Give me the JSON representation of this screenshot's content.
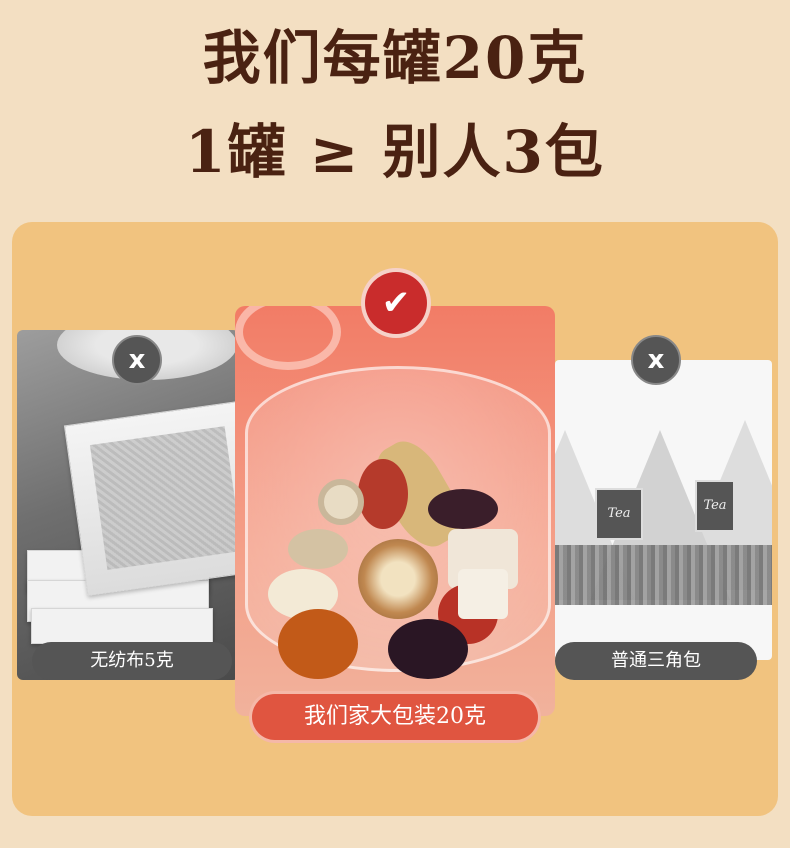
{
  "headline": {
    "line1": "我们每罐20克",
    "line2": "1罐 ≥ 别人3包"
  },
  "left_option": {
    "label": "无纺布5克",
    "mark": "x",
    "status": "rejected"
  },
  "center_option": {
    "label": "我们家大包装20克",
    "mark": "✔",
    "status": "selected"
  },
  "right_option": {
    "label": "普通三角包",
    "mark": "x",
    "status": "rejected",
    "bag_tag_text": "Tea"
  },
  "colors": {
    "background": "#f3dfc2",
    "panel": "#f1c37f",
    "headline_text": "#4a2212",
    "accent_red": "#e05540",
    "rejected_gray": "#555555"
  }
}
